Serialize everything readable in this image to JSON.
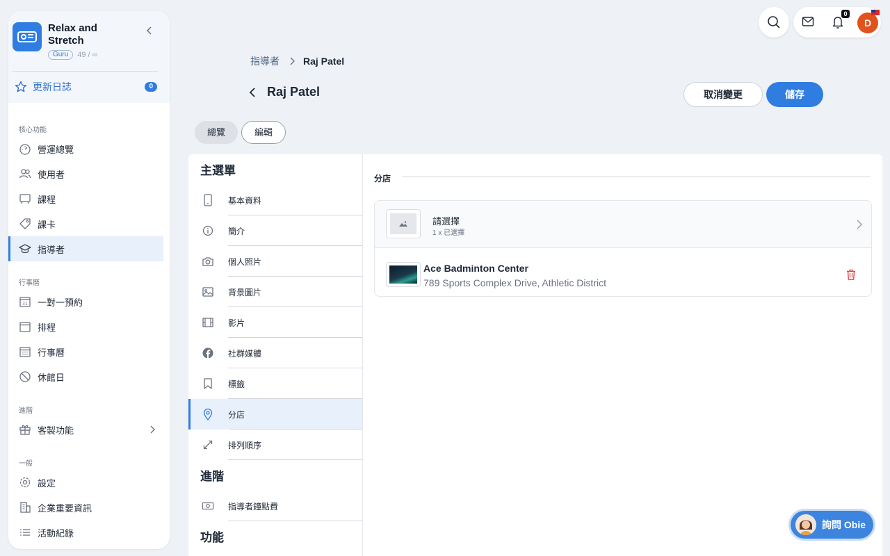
{
  "brand": {
    "name": "Relax and Stretch",
    "badge": "Guru",
    "quota": "49 / ∞"
  },
  "changelog": {
    "label": "更新日誌",
    "count": "0"
  },
  "sidebar": {
    "sections": [
      {
        "title": "核心功能",
        "items": [
          {
            "label": "營運總覽",
            "icon": "dashboard-icon"
          },
          {
            "label": "使用者",
            "icon": "users-icon"
          },
          {
            "label": "課程",
            "icon": "course-icon"
          },
          {
            "label": "課卡",
            "icon": "tag-icon"
          },
          {
            "label": "指導者",
            "icon": "graduation-cap-icon",
            "active": true
          }
        ]
      },
      {
        "title": "行事曆",
        "items": [
          {
            "label": "一對一預約",
            "icon": "calendar-31-icon"
          },
          {
            "label": "排程",
            "icon": "calendar-icon"
          },
          {
            "label": "行事曆",
            "icon": "calendar-grid-icon"
          },
          {
            "label": "休館日",
            "icon": "block-icon"
          }
        ]
      },
      {
        "title": "進階",
        "items": [
          {
            "label": "客製功能",
            "icon": "gift-icon"
          }
        ]
      },
      {
        "title": "一般",
        "items": [
          {
            "label": "設定",
            "icon": "gear-icon"
          },
          {
            "label": "企業重要資訊",
            "icon": "building-icon"
          },
          {
            "label": "活動紀錄",
            "icon": "list-icon"
          }
        ]
      }
    ]
  },
  "topbar": {
    "notifications_count": "0",
    "avatar_initial": "D"
  },
  "breadcrumb": {
    "parent": "指導者",
    "current": "Raj Patel"
  },
  "page": {
    "title": "Raj Patel",
    "cancel_label": "取消變更",
    "save_label": "儲存"
  },
  "tabs": {
    "overview": "總覽",
    "edit": "編輯"
  },
  "menu": {
    "main_heading": "主選單",
    "main_items": [
      {
        "label": "基本資料",
        "icon": "phone-icon"
      },
      {
        "label": "簡介",
        "icon": "info-icon"
      },
      {
        "label": "個人照片",
        "icon": "camera-icon"
      },
      {
        "label": "背景圖片",
        "icon": "image-icon"
      },
      {
        "label": "影片",
        "icon": "film-icon"
      },
      {
        "label": "社群媒體",
        "icon": "facebook-icon"
      },
      {
        "label": "標籤",
        "icon": "bookmark-icon"
      },
      {
        "label": "分店",
        "icon": "location-pin-icon",
        "active": true
      },
      {
        "label": "排列順序",
        "icon": "resize-arrows-icon"
      }
    ],
    "advanced_heading": "進階",
    "advanced_items": [
      {
        "label": "指導者鐘點費",
        "icon": "money-icon"
      }
    ],
    "feature_heading": "功能"
  },
  "branch_panel": {
    "title": "分店",
    "select_label": "請選擇",
    "select_sub": "1 x 已選擇",
    "branch_name": "Ace Badminton Center",
    "branch_address": "789 Sports Complex Drive, Athletic District"
  },
  "assistant": {
    "label": "詢問 Obie"
  },
  "colors": {
    "accent": "#2f7de1",
    "danger": "#e04545",
    "avatar": "#e0521e"
  }
}
